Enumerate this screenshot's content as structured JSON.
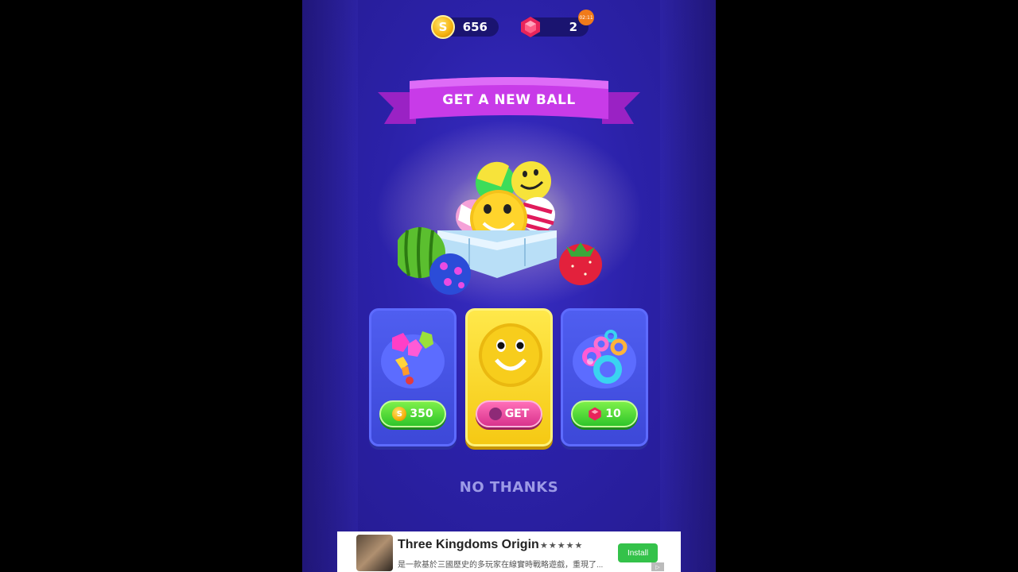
{
  "currency": {
    "coins": "656",
    "gems": "2",
    "timer": "02:11"
  },
  "banner": {
    "title": "GET A NEW BALL"
  },
  "offers": [
    {
      "name": "polyhedron-balls-pack",
      "price": "350",
      "currency_icon": "coin-icon"
    },
    {
      "name": "smiley-ball",
      "price": "GET",
      "currency_icon": "ad-icon"
    },
    {
      "name": "donut-ring-balls-pack",
      "price": "10",
      "currency_icon": "gem-icon"
    }
  ],
  "no_thanks_label": "NO THANKS",
  "ad": {
    "title": "Three Kingdoms Origin",
    "stars": "★★★★★",
    "description": "是一款基於三國歷史的多玩家在線實時戰略遊戲，重現了...",
    "install_label": "Install"
  },
  "colors": {
    "background": "#2b21a8",
    "banner": "#c83be8",
    "card_blue": "#4552e2",
    "card_gold": "#f7d22a",
    "button_green": "#38c82c",
    "button_pink": "#e0418f"
  }
}
